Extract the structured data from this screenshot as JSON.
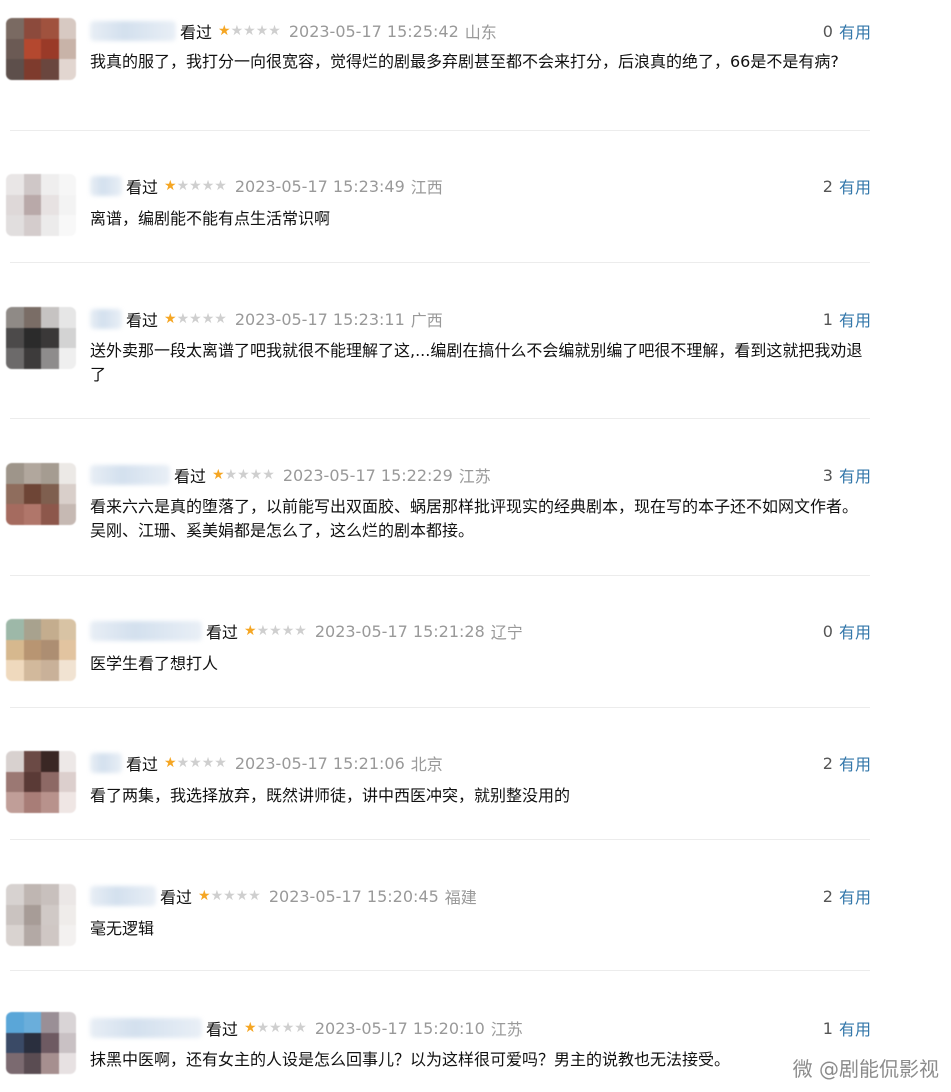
{
  "ui": {
    "watched_label": "看过",
    "useful_label": "有用",
    "star_icon": "★",
    "star_rating": 1,
    "star_max": 5,
    "colors": {
      "star_on": "#f5a623",
      "star_off": "#cfcfcf",
      "useful_link": "#3377aa",
      "meta_gray": "#999999"
    }
  },
  "comments": [
    {
      "time": "2023-05-17 15:25:42",
      "location": "山东",
      "votes": "0",
      "text": "我真的服了，我打分一向很宽容，觉得烂的剧最多弃剧甚至都不会来打分，后浪真的绝了，66是不是有病?"
    },
    {
      "time": "2023-05-17 15:23:49",
      "location": "江西",
      "votes": "2",
      "text": "离谱，编剧能不能有点生活常识啊"
    },
    {
      "time": "2023-05-17 15:23:11",
      "location": "广西",
      "votes": "1",
      "text": "送外卖那一段太离谱了吧我就很不能理解了这,...编剧在搞什么不会编就别编了吧很不理解，看到这就把我劝退了"
    },
    {
      "time": "2023-05-17 15:22:29",
      "location": "江苏",
      "votes": "3",
      "text": "看来六六是真的堕落了，以前能写出双面胶、蜗居那样批评现实的经典剧本，现在写的本子还不如网文作者。吴刚、江珊、奚美娟都是怎么了，这么烂的剧本都接。"
    },
    {
      "time": "2023-05-17 15:21:28",
      "location": "辽宁",
      "votes": "0",
      "text": "医学生看了想打人"
    },
    {
      "time": "2023-05-17 15:21:06",
      "location": "北京",
      "votes": "2",
      "text": "看了两集，我选择放弃，既然讲师徒，讲中西医冲突，就别整没用的"
    },
    {
      "time": "2023-05-17 15:20:45",
      "location": "福建",
      "votes": "2",
      "text": "毫无逻辑"
    },
    {
      "time": "2023-05-17 15:20:10",
      "location": "江苏",
      "votes": "1",
      "text": "抹黑中医啊，还有女主的人设是怎么回事儿？以为这样很可爱吗？男主的说教也无法接受。"
    }
  ],
  "watermark": "微 @剧能侃影视"
}
